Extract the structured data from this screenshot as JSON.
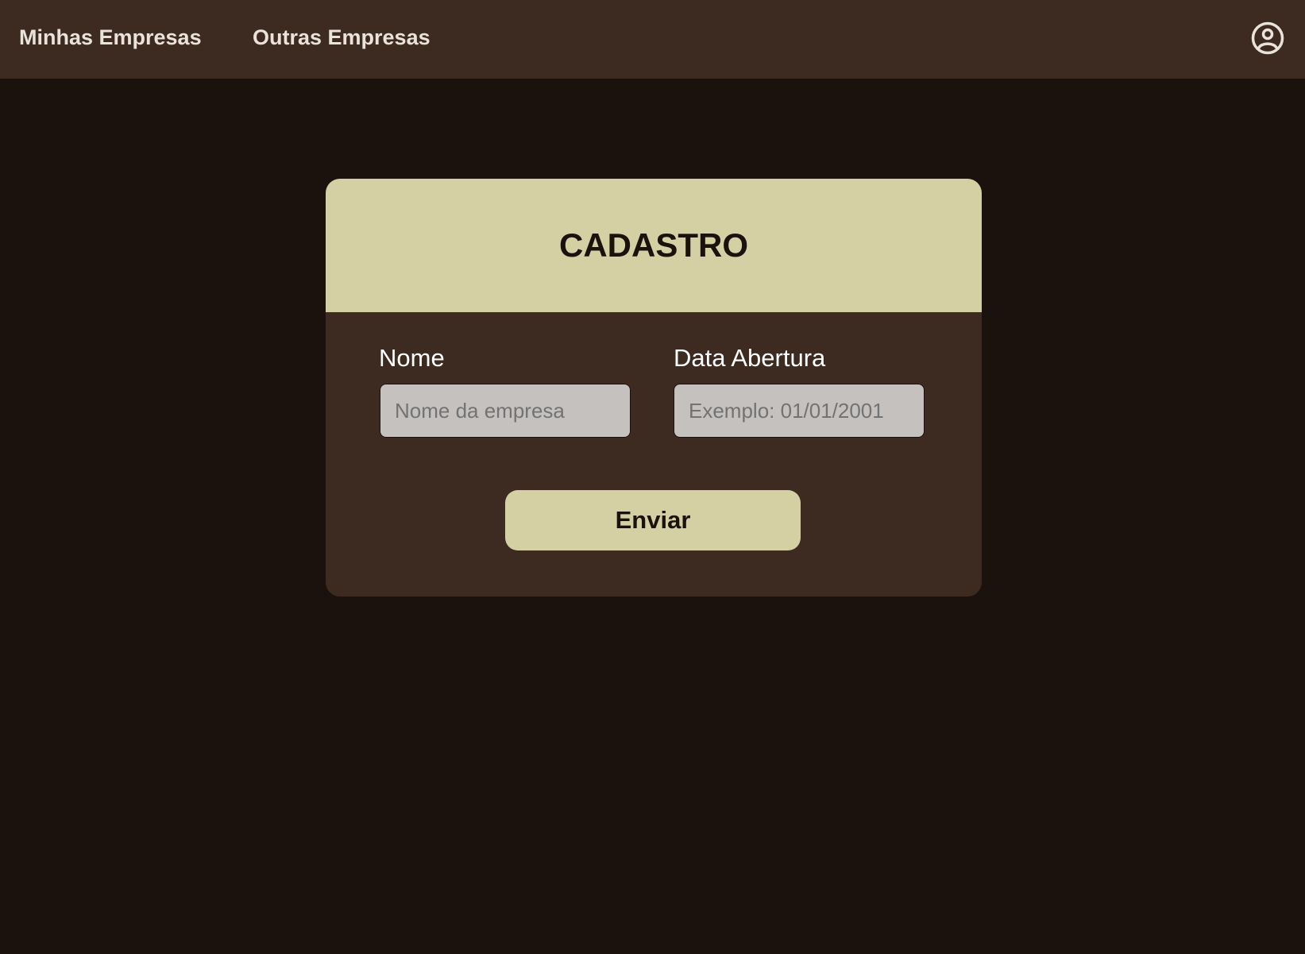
{
  "nav": {
    "links": [
      {
        "label": "Minhas Empresas"
      },
      {
        "label": "Outras Empresas"
      }
    ],
    "user_icon": "user-circle-icon"
  },
  "form": {
    "title": "CADASTRO",
    "fields": {
      "nome": {
        "label": "Nome",
        "placeholder": "Nome da empresa",
        "value": ""
      },
      "data_abertura": {
        "label": "Data Abertura",
        "placeholder": "Exemplo: 01/01/2001",
        "value": ""
      }
    },
    "submit_label": "Enviar"
  },
  "colors": {
    "page_background": "#1b120d",
    "topbar_background": "#3d2a21",
    "card_background": "#3d2a21",
    "accent": "#d5cfa4",
    "input_background": "#c4c1bf",
    "nav_text": "#e9e3da"
  }
}
